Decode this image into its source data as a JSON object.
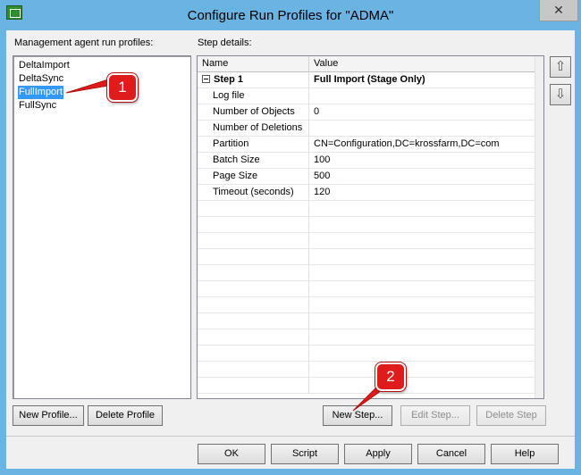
{
  "window": {
    "title": "Configure Run Profiles for \"ADMA\"",
    "close_glyph": "✕"
  },
  "profiles": {
    "label": "Management agent run profiles:",
    "items": [
      "DeltaImport",
      "DeltaSync",
      "FullImport",
      "FullSync"
    ],
    "selected": "FullImport",
    "new_button": "New Profile...",
    "delete_button": "Delete Profile"
  },
  "steps": {
    "label": "Step details:",
    "columns": [
      "Name",
      "Value"
    ],
    "step_row": {
      "name": "Step 1",
      "value": "Full Import (Stage Only)"
    },
    "rows": [
      {
        "name": "Log file",
        "value": ""
      },
      {
        "name": "Number of Objects",
        "value": "0"
      },
      {
        "name": "Number of Deletions",
        "value": ""
      },
      {
        "name": "Partition",
        "value": "CN=Configuration,DC=krossfarm,DC=com"
      },
      {
        "name": "Batch Size",
        "value": "100"
      },
      {
        "name": "Page Size",
        "value": "500"
      },
      {
        "name": "Timeout (seconds)",
        "value": "120"
      }
    ],
    "new_button": "New Step...",
    "edit_button": "Edit Step...",
    "delete_button": "Delete Step",
    "move_up_glyph": "⇧",
    "move_down_glyph": "⇩"
  },
  "footer": {
    "ok": "OK",
    "script": "Script",
    "apply": "Apply",
    "cancel": "Cancel",
    "help": "Help"
  },
  "annotations": {
    "callout_1": "1",
    "callout_2": "2",
    "color": "#e01b1b"
  }
}
